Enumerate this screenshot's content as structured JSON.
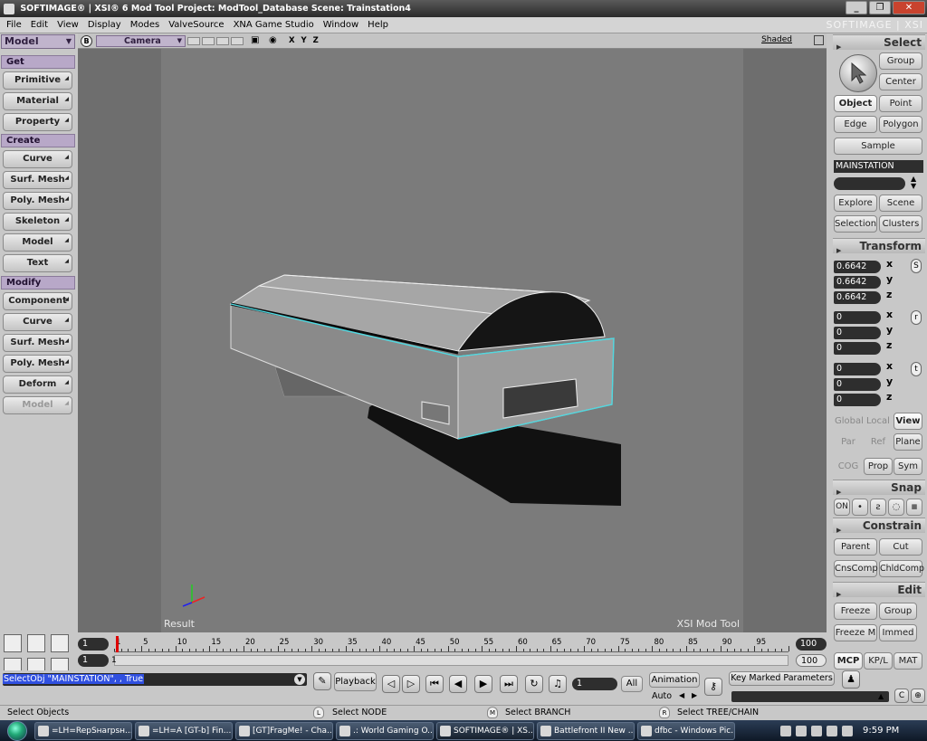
{
  "app": {
    "title": "SOFTIMAGE® | XSI® 6 Mod Tool Project: ModTool_Database    Scene: Trainstation4",
    "brand": "SOFTIMAGE | XSI"
  },
  "menu": [
    "File",
    "Edit",
    "View",
    "Display",
    "Modes",
    "ValveSource",
    "XNA Game Studio",
    "Window",
    "Help"
  ],
  "left_panel": {
    "mode": "Model",
    "sections": {
      "get": "Get",
      "create": "Create",
      "modify": "Modify"
    },
    "get_items": [
      "Primitive",
      "Material",
      "Property"
    ],
    "create_items": [
      "Curve",
      "Surf. Mesh",
      "Poly. Mesh",
      "Skeleton",
      "Model",
      "Text"
    ],
    "modify_items": [
      "Component",
      "Curve",
      "Surf. Mesh",
      "Poly. Mesh",
      "Deform",
      "Model"
    ]
  },
  "viewport": {
    "b_label": "B",
    "camera": "Camera",
    "axes": "X Y Z",
    "display_mode": "Shaded",
    "result_label": "Result",
    "watermark": "XSI Mod Tool"
  },
  "timeline": {
    "start": "1",
    "start2": "1",
    "end": "100",
    "end2": "100",
    "current_marker": "1",
    "ticks": [
      "1",
      "5",
      "10",
      "15",
      "20",
      "25",
      "30",
      "35",
      "40",
      "45",
      "50",
      "55",
      "60",
      "65",
      "70",
      "75",
      "80",
      "85",
      "90",
      "95"
    ]
  },
  "command_line": {
    "text": "SelectObj \"MAINSTATION\", , True"
  },
  "playback": {
    "playback_label": "Playback",
    "frame": "1",
    "all_label": "All",
    "animation_label": "Animation",
    "auto_label": "Auto",
    "key_marked": "Key Marked Parameters"
  },
  "status": {
    "left": "Select Objects",
    "l_key": "L",
    "l_text": "Select NODE",
    "m_key": "M",
    "m_text": "Select BRANCH",
    "r_key": "R",
    "r_text": "Select TREE/CHAIN"
  },
  "right_panel": {
    "select_header": "Select",
    "group": "Group",
    "center": "Center",
    "object": "Object",
    "point": "Point",
    "edge": "Edge",
    "polygon": "Polygon",
    "sample": "Sample",
    "object_name": "MAINSTATION",
    "explore": "Explore",
    "scene": "Scene",
    "selection": "Selection",
    "clusters": "Clusters",
    "transform_header": "Transform",
    "scale": [
      "0.6642",
      "0.6642",
      "0.6642"
    ],
    "rotate": [
      "0",
      "0",
      "0"
    ],
    "translate": [
      "0",
      "0",
      "0"
    ],
    "axes": [
      "x",
      "y",
      "z"
    ],
    "srt": [
      "S",
      "r",
      "t"
    ],
    "global": "Global",
    "local": "Local",
    "view": "View",
    "par": "Par",
    "ref": "Ref",
    "plane": "Plane",
    "cog": "COG",
    "prop": "Prop",
    "sym": "Sym",
    "snap_header": "Snap",
    "snap_on": "ON",
    "constrain_header": "Constrain",
    "parent": "Parent",
    "cut": "Cut",
    "cnscomp": "CnsComp",
    "chldcomp": "ChldComp",
    "edit_header": "Edit",
    "freeze": "Freeze",
    "edit_group": "Group",
    "freeze_m": "Freeze M",
    "immed": "Immed",
    "tabs": [
      "MCP",
      "KP/L",
      "MAT"
    ]
  },
  "taskbar": {
    "tasks": [
      "=LH=RepSнarpsн...",
      "=LH=A [GT-b] Fin...",
      "[GT]FragMe! - Cha...",
      ".: World Gaming O...",
      "SOFTIMAGE® | XS...",
      "Battlefront II New ...",
      "dfbc - Windows Pic..."
    ],
    "clock": "9:59 PM"
  }
}
